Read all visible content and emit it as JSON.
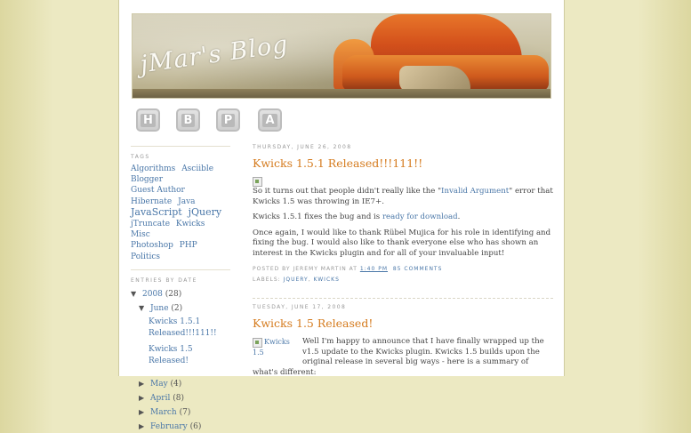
{
  "header": {
    "blog_title": "jMar's Blog"
  },
  "nav": [
    "H",
    "B",
    "P",
    "A"
  ],
  "sidebar": {
    "tags_heading": "TAGS",
    "tags": [
      {
        "label": "Algorithms",
        "big": false
      },
      {
        "label": "Asciible",
        "big": false
      },
      {
        "label": "Blogger",
        "big": false
      },
      {
        "label": "Guest Author",
        "big": false
      },
      {
        "label": "Hibernate",
        "big": false
      },
      {
        "label": "Java",
        "big": false
      },
      {
        "label": "JavaScript",
        "big": true
      },
      {
        "label": "jQuery",
        "big": true
      },
      {
        "label": "jTruncate",
        "big": false
      },
      {
        "label": "Kwicks",
        "big": false
      },
      {
        "label": "Misc",
        "big": false
      },
      {
        "label": "Photoshop",
        "big": false
      },
      {
        "label": "PHP",
        "big": false
      },
      {
        "label": "Politics",
        "big": false
      }
    ],
    "archive_heading": "ENTRIES BY DATE",
    "archive": {
      "year": "2008",
      "year_count": "(28)",
      "open_month": "June",
      "open_month_count": "(2)",
      "posts": [
        "Kwicks 1.5.1 Released!!!111!!",
        "Kwicks 1.5 Released!"
      ],
      "months": [
        {
          "label": "May",
          "count": "(4)"
        },
        {
          "label": "April",
          "count": "(8)"
        },
        {
          "label": "March",
          "count": "(7)"
        },
        {
          "label": "February",
          "count": "(6)"
        }
      ]
    }
  },
  "posts": [
    {
      "date": "THURSDAY, JUNE 26, 2008",
      "title": "Kwicks 1.5.1 Released!!!111!!",
      "p1_a": "So it turns out that people didn't really like the \"",
      "p1_link": "Invalid Argument",
      "p1_b": "\" error that Kwicks 1.5 was throwing in IE7+.",
      "p2_a": "Kwicks 1.5.1 fixes the bug and is ",
      "p2_link": "ready for download",
      "p2_b": ".",
      "p3": "Once again, I would like to thank Rübel Mujica for his role in identifying and fixing the bug. I would also like to thank everyone else who has shown an interest in the Kwicks plugin and for all of your invaluable input!",
      "posted_by": "POSTED BY JEREMY MARTIN AT ",
      "time": "1:40 PM",
      "comments": "85 COMMENTS",
      "labels_prefix": "LABELS: ",
      "labels": [
        "JQUERY",
        "KWICKS"
      ]
    },
    {
      "date": "TUESDAY, JUNE 17, 2008",
      "title": "Kwicks 1.5 Released!",
      "img_alt": "Kwicks 1.5",
      "body": "Well I'm happy to announce that I have finally wrapped up the v1.5 update to the Kwicks plugin. Kwicks 1.5 builds upon the original release in several big ways - here is a summary of what's different:"
    }
  ]
}
